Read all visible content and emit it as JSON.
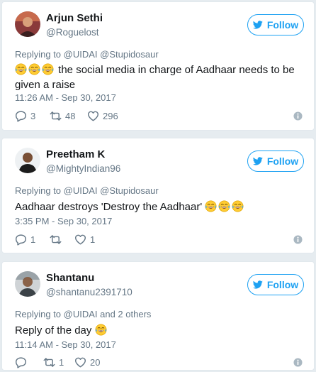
{
  "tweets": [
    {
      "name": "Arjun Sethi",
      "handle": "@Roguelost",
      "follow_label": "Follow",
      "reply_to": "Replying to @UIDAI @Stupidosaur",
      "text_main": "the social media in charge of Aadhaar needs to be given a raise",
      "time": "11:26 AM - Sep 30, 2017",
      "reply_count": "3",
      "retweet_count": "48",
      "like_count": "296"
    },
    {
      "name": "Preetham K",
      "handle": "@MightyIndian96",
      "follow_label": "Follow",
      "reply_to": "Replying to @UIDAI @Stupidosaur",
      "text_main": "Aadhaar destroys 'Destroy the Aadhaar'",
      "time": "3:35 PM - Sep 30, 2017",
      "reply_count": "1",
      "retweet_count": "",
      "like_count": "1"
    },
    {
      "name": "Shantanu",
      "handle": "@shantanu2391710",
      "follow_label": "Follow",
      "reply_to": "Replying to @UIDAI and 2 others",
      "text_main": "Reply of the day",
      "time": "11:14 AM - Sep 30, 2017",
      "reply_count": "",
      "retweet_count": "1",
      "like_count": "20"
    }
  ],
  "icons": {
    "follow": "twitter-bird-icon",
    "emoji": "face-with-tears-of-joy-icon",
    "reply": "reply-icon",
    "retweet": "retweet-icon",
    "like": "heart-icon",
    "info": "info-icon"
  },
  "colors": {
    "accent": "#1da1f2",
    "muted": "#657786",
    "text": "#14171a",
    "background": "#e6ecf0"
  }
}
